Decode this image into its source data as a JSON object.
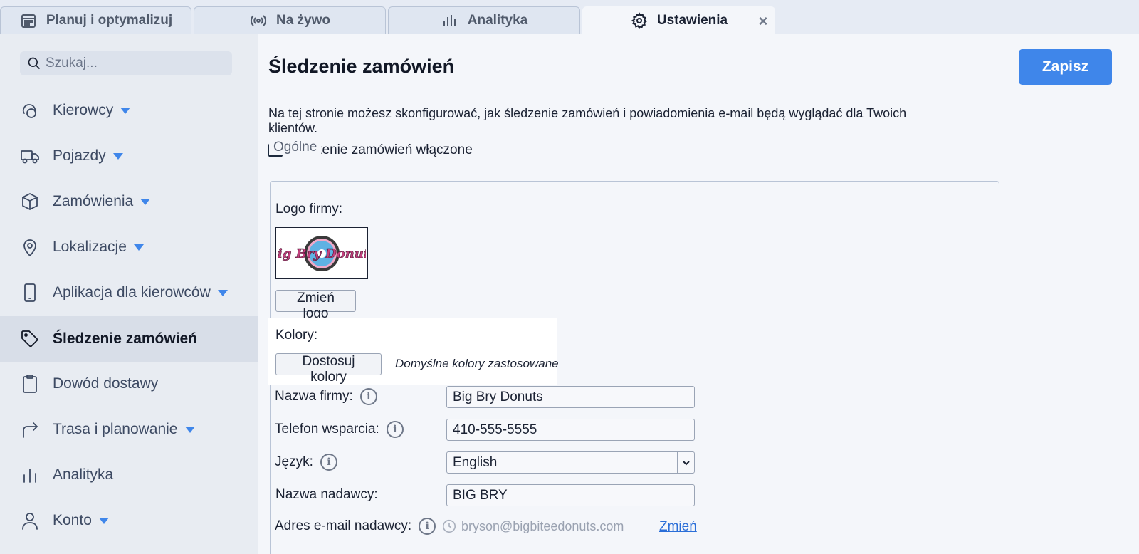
{
  "tabs": [
    {
      "label": "Planuj i optymalizuj",
      "icon": "calendar-icon"
    },
    {
      "label": "Na żywo",
      "icon": "broadcast-icon"
    },
    {
      "label": "Analityka",
      "icon": "bar-chart-icon"
    },
    {
      "label": "Ustawienia",
      "icon": "gear-icon",
      "active": true
    }
  ],
  "sidebar": {
    "search_placeholder": "Szukaj...",
    "items": [
      {
        "label": "Kierowcy",
        "icon": "drivers-icon",
        "caret": true
      },
      {
        "label": "Pojazdy",
        "icon": "truck-icon",
        "caret": true
      },
      {
        "label": "Zamówienia",
        "icon": "box-icon",
        "caret": true
      },
      {
        "label": "Lokalizacje",
        "icon": "map-pin-icon",
        "caret": true
      },
      {
        "label": "Aplikacja dla kierowców",
        "icon": "phone-icon",
        "caret": true
      },
      {
        "label": "Śledzenie zamówień",
        "icon": "tag-icon",
        "active": true
      },
      {
        "label": "Dowód dostawy",
        "icon": "clipboard-icon"
      },
      {
        "label": "Trasa i planowanie",
        "icon": "route-arrow-icon",
        "caret": true
      },
      {
        "label": "Analityka",
        "icon": "bar-chart-icon"
      },
      {
        "label": "Konto",
        "icon": "user-icon",
        "caret": true
      }
    ]
  },
  "main": {
    "title": "Śledzenie zamówień",
    "save_label": "Zapisz",
    "description": "Na tej stronie możesz skonfigurować, jak śledzenie zamówień i powiadomienia e-mail będą wyglądać dla Twoich klientów.",
    "tracking_enabled_label": "Śledzenie zamówień włączone",
    "tracking_enabled": true,
    "general": {
      "legend": "Ogólne",
      "logo_label": "Logo firmy:",
      "logo_text": "Big Bry Donuts",
      "change_logo_label": "Zmień logo",
      "colors_label": "Kolory:",
      "customize_colors_label": "Dostosuj kolory",
      "colors_note": "Domyślne kolory zastosowane",
      "company_name_label": "Nazwa firmy:",
      "company_name_value": "Big Bry Donuts",
      "support_phone_label": "Telefon wsparcia:",
      "support_phone_value": "410-555-5555",
      "language_label": "Język:",
      "language_value": "English",
      "sender_name_label": "Nazwa nadawcy:",
      "sender_name_value": "BIG BRY",
      "sender_email_label": "Adres e-mail nadawcy:",
      "sender_email_value": "bryson@bigbiteedonuts.com",
      "change_link_label": "Zmień"
    }
  },
  "colors": {
    "accent": "#3f86ea",
    "sidebar_bg": "#e8ecf2",
    "main_bg": "#f4f6fa"
  }
}
